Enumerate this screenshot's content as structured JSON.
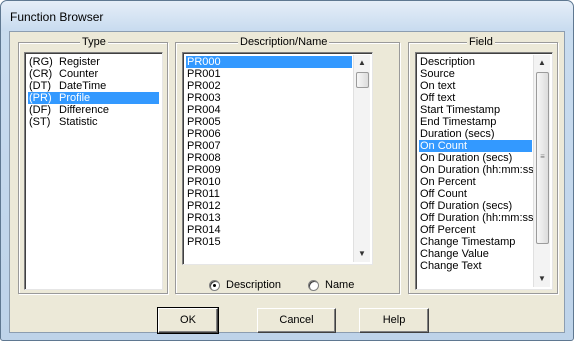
{
  "window": {
    "title": "Function Browser"
  },
  "type_group": {
    "title": "Type",
    "items": [
      {
        "code": "(RG)",
        "label": "Register",
        "selected": false
      },
      {
        "code": "(CR)",
        "label": "Counter",
        "selected": false
      },
      {
        "code": "(DT)",
        "label": "DateTime",
        "selected": false
      },
      {
        "code": "(PR)",
        "label": "Profile",
        "selected": true
      },
      {
        "code": "(DF)",
        "label": "Difference",
        "selected": false
      },
      {
        "code": "(ST)",
        "label": "Statistic",
        "selected": false
      }
    ]
  },
  "desc_group": {
    "title": "Description/Name",
    "items": [
      "PR000",
      "PR001",
      "PR002",
      "PR003",
      "PR004",
      "PR005",
      "PR006",
      "PR007",
      "PR008",
      "PR009",
      "PR010",
      "PR011",
      "PR012",
      "PR013",
      "PR014",
      "PR015"
    ],
    "selected_index": 0,
    "radio_description": "Description",
    "radio_name": "Name",
    "radio_selected": "description"
  },
  "field_group": {
    "title": "Field",
    "items": [
      "Description",
      "Source",
      "On text",
      "Off text",
      "Start Timestamp",
      "End Timestamp",
      "Duration (secs)",
      "On Count",
      "On Duration (secs)",
      "On Duration (hh:mm:ss)",
      "On Percent",
      "Off Count",
      "Off Duration (secs)",
      "Off Duration (hh:mm:ss)",
      "Off Percent",
      "Change Timestamp",
      "Change Value",
      "Change Text"
    ],
    "selected_index": 7
  },
  "icons": {
    "scroll_up": "scroll-up-arrow-icon",
    "scroll_down": "scroll-down-arrow-icon",
    "thumb_grip": "scrollbar-grip-icon"
  },
  "buttons": {
    "ok": "OK",
    "cancel": "Cancel",
    "help": "Help"
  },
  "colors": {
    "selection": "#3399ff",
    "dialog_bg": "#ece9d8"
  }
}
